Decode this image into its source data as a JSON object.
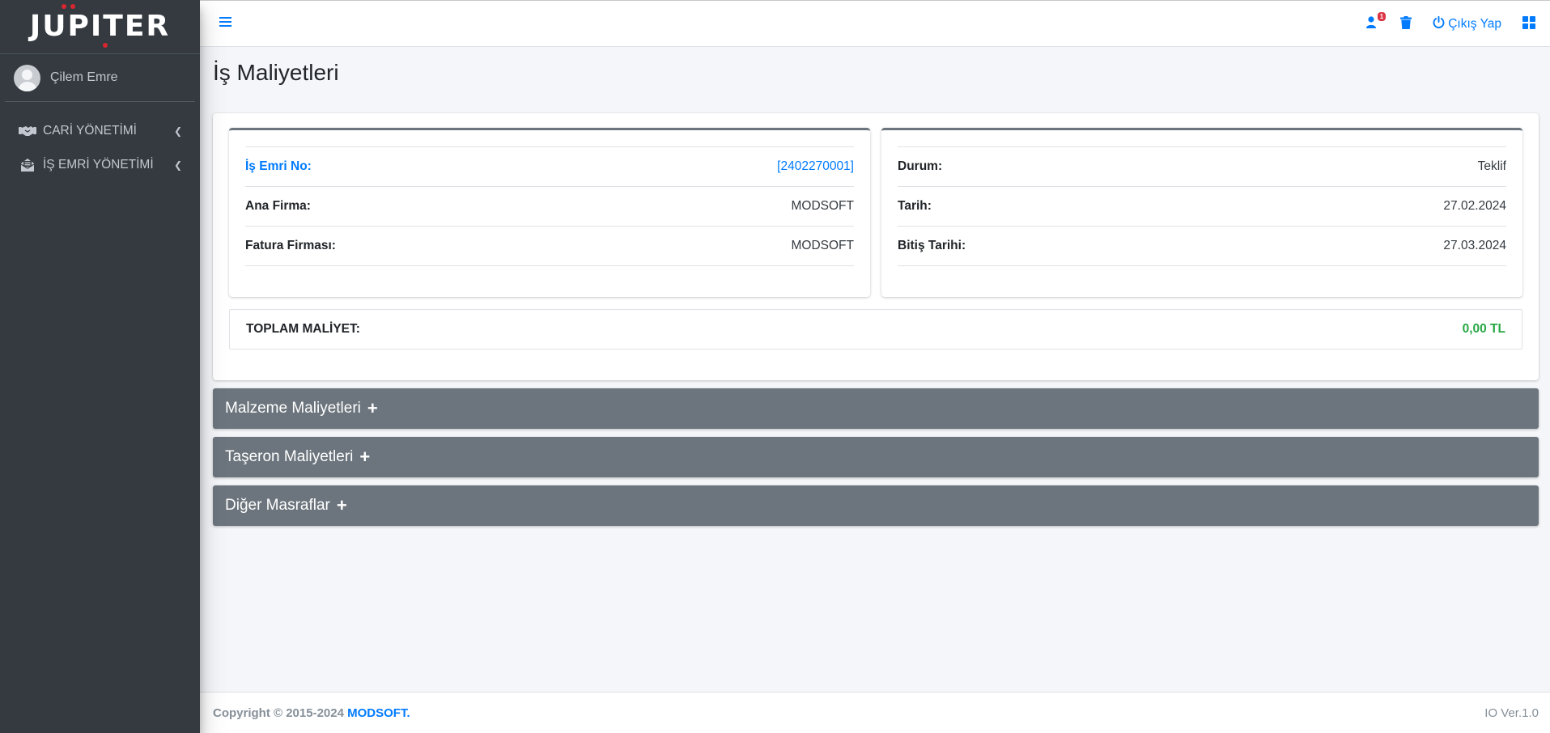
{
  "brand": {
    "name": "JUPITER"
  },
  "user": {
    "name": "Çilem Emre"
  },
  "sidebar": {
    "items": [
      {
        "label": "CARİ YÖNETİMİ",
        "icon": "handshake-icon"
      },
      {
        "label": "İŞ EMRİ YÖNETİMİ",
        "icon": "envelope-open-icon"
      }
    ]
  },
  "topbar": {
    "notification_count": "1",
    "logout_label": "Çıkış Yap"
  },
  "page": {
    "title": "İş Maliyetleri"
  },
  "info_left": {
    "rows": [
      {
        "label": "İş Emri No:",
        "value": "[2402270001]"
      },
      {
        "label": "Ana Firma:",
        "value": "MODSOFT"
      },
      {
        "label": "Fatura Firması:",
        "value": "MODSOFT"
      }
    ]
  },
  "info_right": {
    "rows": [
      {
        "label": "Durum:",
        "value": "Teklif"
      },
      {
        "label": "Tarih:",
        "value": "27.02.2024"
      },
      {
        "label": "Bitiş Tarihi:",
        "value": "27.03.2024"
      }
    ]
  },
  "total": {
    "label": "TOPLAM MALİYET:",
    "value": "0,00 TL"
  },
  "sections": [
    {
      "title": "Malzeme Maliyetleri",
      "toggle": "+"
    },
    {
      "title": "Taşeron Maliyetleri",
      "toggle": "+"
    },
    {
      "title": "Diğer Masraflar",
      "toggle": "+"
    }
  ],
  "footer": {
    "copyright": "Copyright © 2015-2024",
    "company": "MODSOFT.",
    "version": "IO Ver.1.0"
  },
  "colors": {
    "sidebar_bg": "#343a40",
    "primary": "#007bff",
    "success": "#28a745",
    "section_bg": "#6c757d",
    "danger": "#dc3545"
  }
}
